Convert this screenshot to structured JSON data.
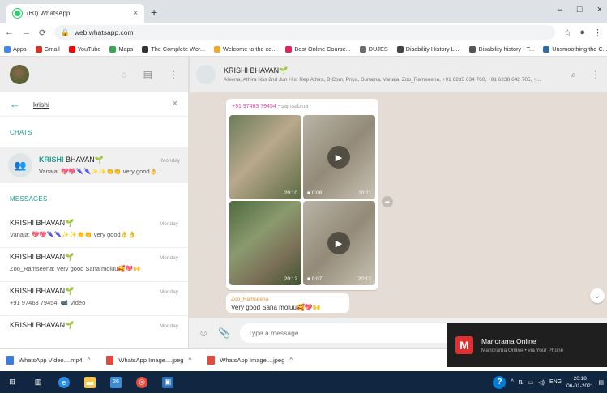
{
  "browser": {
    "tab_title": "(60) WhatsApp",
    "tab_close": "×",
    "new_tab": "+",
    "url": "web.whatsapp.com",
    "window_controls": [
      "–",
      "□",
      "×"
    ],
    "bookmarks": [
      {
        "label": "Apps",
        "icon_color": "#4285f4"
      },
      {
        "label": "Gmail",
        "icon_color": "#d93025"
      },
      {
        "label": "YouTube",
        "icon_color": "#ff0000"
      },
      {
        "label": "Maps",
        "icon_color": "#34a853"
      },
      {
        "label": "The Complete Wor...",
        "icon_color": "#333333"
      },
      {
        "label": "Welcome to the co...",
        "icon_color": "#f5a623"
      },
      {
        "label": "Best Online Course...",
        "icon_color": "#e0245e"
      },
      {
        "label": "DUJES",
        "icon_color": "#6b6b6b"
      },
      {
        "label": "Disability History Li...",
        "icon_color": "#444444"
      },
      {
        "label": "Disability history - T...",
        "icon_color": "#555555"
      },
      {
        "label": "Unsmoothing the C...",
        "icon_color": "#2b6cb0"
      }
    ]
  },
  "left": {
    "search_query": "krishi",
    "chats_header": "CHATS",
    "chat": {
      "name_highlight": "KRISHI",
      "name_rest": " BHAVAN",
      "emoji": "🌱",
      "time": "Monday",
      "preview": "Vanaja: 💖💖🌂🌂✨✨👏👏 very good👌..."
    },
    "messages_header": "MESSAGES",
    "messages": [
      {
        "name": "KRISHI BHAVAN🌱",
        "time": "Monday",
        "preview": "Vanaja: 💖💖🌂🌂✨✨👏👏 very good👌👌"
      },
      {
        "name": "KRISHI BHAVAN🌱",
        "time": "Monday",
        "preview": "Zoo_Ramseena: Very good Sana moluu🥰💖🙌"
      },
      {
        "name": "KRISHI BHAVAN🌱",
        "time": "Monday",
        "preview": "+91 97463 79454: 📹 Video"
      },
      {
        "name": "KRISHI BHAVAN🌱",
        "time": "Monday",
        "preview": ""
      }
    ]
  },
  "conversation": {
    "title": "KRISHI BHAVAN🌱",
    "members": "Aleena, Athira Nss 2nd Jun Hist Rep Athira, B Com, Priya, Sunaina, Vanaja, Zoo_Ramseena, +91 6235 634 760, +91 6238 642 705, +...",
    "bubble": {
      "sender": "+91 97463 79454",
      "sender_alias": "~sajnsabina",
      "media": [
        {
          "type": "photo",
          "time": "20:10",
          "duration": ""
        },
        {
          "type": "video",
          "time": "20:11",
          "duration": "0:08"
        },
        {
          "type": "photo",
          "time": "20:12",
          "duration": ""
        },
        {
          "type": "video",
          "time": "20:12",
          "duration": "0:07"
        }
      ]
    },
    "bubble2": {
      "sender": "Zoo_Ramseena",
      "text": "Very good Sana moluu🥰💖🙌"
    },
    "composer_placeholder": "Type a message"
  },
  "downloads": [
    {
      "label": "WhatsApp Video....mp4",
      "color": "#3b7ddd"
    },
    {
      "label": "WhatsApp Image....jpeg",
      "color": "#e04a3f"
    },
    {
      "label": "WhatsApp Image....jpeg",
      "color": "#e04a3f"
    }
  ],
  "notification": {
    "title": "Manorama Online",
    "subtitle": "Manorama Online • via Your Phone"
  },
  "taskbar": {
    "badge": "26",
    "lang": "ENG",
    "time": "20:18",
    "date": "06-01-2021"
  }
}
